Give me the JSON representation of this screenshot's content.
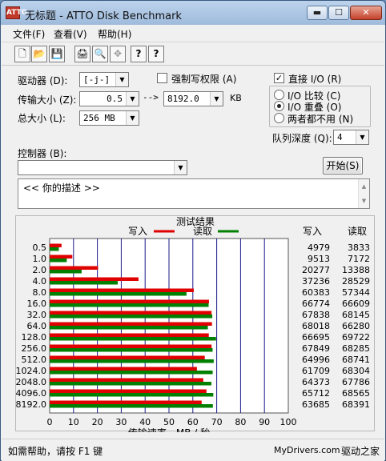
{
  "window": {
    "title": "无标题 - ATTO Disk Benchmark",
    "app_icon": "ATTO",
    "min": "▬",
    "max": "☐",
    "close": "✕"
  },
  "menubar": {
    "file": "文件(F)",
    "view": "查看(V)",
    "help": "帮助(H)"
  },
  "toolbar": {
    "new": "🗋",
    "open": "📂",
    "save": "💾",
    "print": "🖨",
    "preview": "🔍",
    "move": "✥",
    "help": "?",
    "whatsthis": "?"
  },
  "controls": {
    "drive_label": "驱动器 (D):",
    "drive_value": "[-j-]",
    "transfer_label": "传输大小 (Z):",
    "transfer_from": "0.5",
    "arrow": "-->",
    "transfer_to": "8192.0",
    "transfer_unit": "KB",
    "total_label": "总大小 (L):",
    "total_value": "256 MB",
    "force_write_label": "强制写权限 (A)",
    "direct_io_label": "直接 I/O (R)",
    "direct_io_checked": "✓",
    "io_compare": "I/O 比较 (C)",
    "io_overlap": "I/O 重叠 (O)",
    "io_neither": "两者都不用 (N)",
    "queue_label": "队列深度 (Q):",
    "queue_value": "4",
    "controller_label": "控制器 (B):",
    "start_button": "开始(S)",
    "description": "<<   你的描述   >>",
    "scroll_up": "▲",
    "scroll_down": "▼",
    "dropdown": "▼"
  },
  "results": {
    "title": "测试结果",
    "legend_write": "写入",
    "legend_read": "读取",
    "col_write": "写入",
    "col_read": "读取",
    "xlabel": "传输速率 - MB / 秒",
    "colors": {
      "write": "#e00000",
      "read": "#008000"
    }
  },
  "chart_data": {
    "type": "bar",
    "title": "测试结果",
    "xlabel": "传输速率 - MB / 秒",
    "ylabel": "",
    "xlim": [
      0,
      100
    ],
    "x_ticks": [
      0,
      10,
      20,
      30,
      40,
      50,
      60,
      70,
      80,
      90,
      100
    ],
    "categories": [
      "0.5",
      "1.0",
      "2.0",
      "4.0",
      "8.0",
      "16.0",
      "32.0",
      "64.0",
      "128.0",
      "256.0",
      "512.0",
      "1024.0",
      "2048.0",
      "4096.0",
      "8192.0"
    ],
    "series": [
      {
        "name": "写入",
        "values": [
          4979,
          9513,
          20277,
          37236,
          60383,
          66774,
          67838,
          68018,
          66695,
          67849,
          64996,
          61709,
          64373,
          65712,
          63685
        ]
      },
      {
        "name": "读取",
        "values": [
          3833,
          7172,
          13388,
          28529,
          57344,
          66609,
          68145,
          66280,
          69722,
          68285,
          68741,
          68304,
          67786,
          68565,
          68391
        ]
      }
    ],
    "legend": "top",
    "grid": true
  },
  "statusbar": {
    "help": "如需帮助，请按 F1 键",
    "site": "MyDrivers.com",
    "brand": "驱动之家"
  }
}
